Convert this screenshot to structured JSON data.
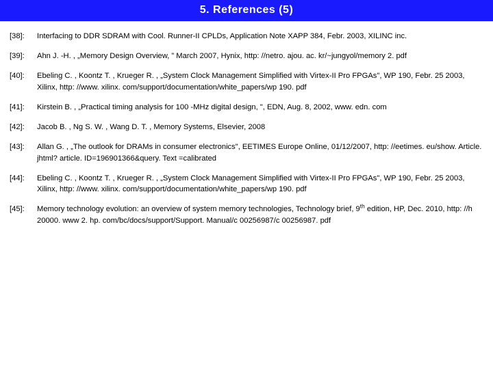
{
  "title": "5. References (5)",
  "refs": [
    {
      "num": "[38]:",
      "body": "Interfacing to DDR SDRAM with Cool. Runner-II CPLDs, Application Note XAPP 384, Febr. 2003, XILINC inc."
    },
    {
      "num": "[39]:",
      "body": "Ahn J. -H. , „Memory Design Overview, ” March 2007, Hynix, http: //netro. ajou. ac. kr/~jungyol/memory 2. pdf"
    },
    {
      "num": "[40]:",
      "body": "Ebeling C. , Koontz T. , Krueger R. , „System Clock Management Simplified with Virtex-II Pro FPGAs\", WP 190, Febr. 25 2003, Xilinx, http: //www. xilinx. com/support/documentation/white_papers/wp 190. pdf"
    },
    {
      "num": "[41]:",
      "body": "Kirstein B. , „Practical timing analysis for 100 -MHz digital design, \",  EDN, Aug. 8, 2002, www. edn. com"
    },
    {
      "num": "[42]:",
      "body": "Jacob B. , Ng S. W. , Wang D. T. , Memory Systems, Elsevier, 2008"
    },
    {
      "num": "[43]:",
      "body": "Allan G. , „The outlook for DRAMs in consumer electronics\", EETIMES Europe Online, 01/12/2007, http: //eetimes. eu/show. Article. jhtml? article. ID=196901366&query. Text =calibrated"
    },
    {
      "num": "[44]:",
      "body": "Ebeling C. , Koontz T. , Krueger R. , „System Clock Management Simplified with Virtex-II Pro FPGAs\", WP 190, Febr. 25 2003, Xilinx, http: //www. xilinx. com/support/documentation/white_papers/wp 190. pdf"
    },
    {
      "num": "[45]:",
      "body_html": "Memory technology evolution: an overview of system memory technologies, Technology brief, 9<sup>th</sup> edition, HP, Dec. 2010, http: //h 20000. www 2. hp. com/bc/docs/support/Support. Manual/c 00256987/c 00256987. pdf"
    }
  ]
}
